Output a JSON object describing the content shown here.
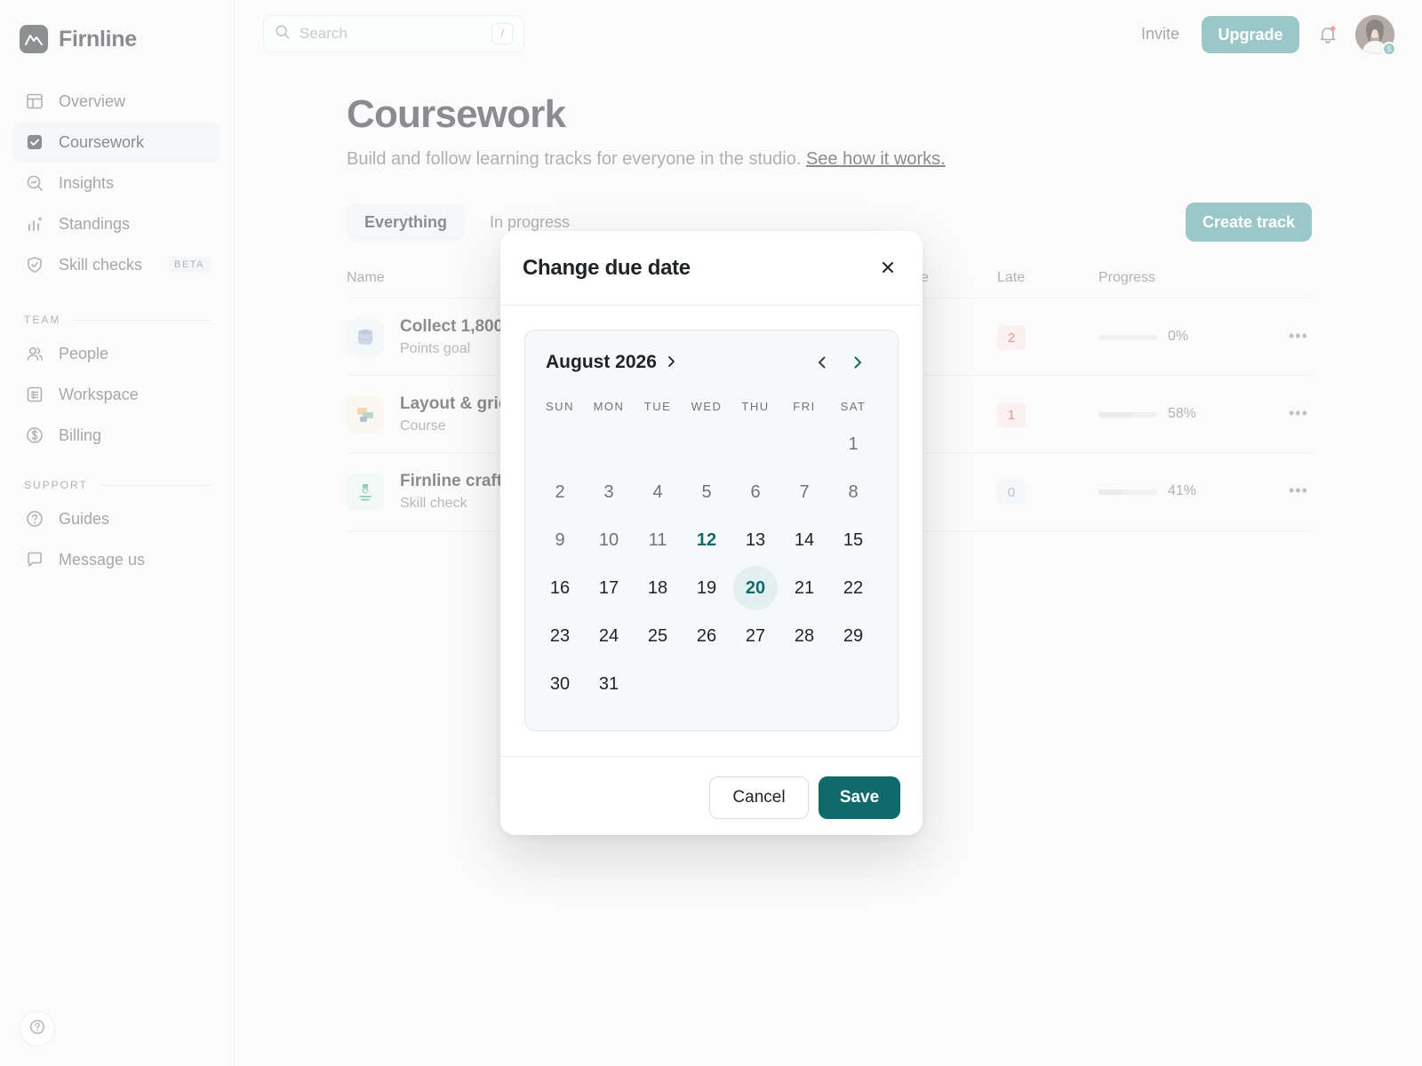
{
  "brand": {
    "name": "Firnline"
  },
  "sidebar": {
    "main_items": [
      {
        "label": "Overview",
        "icon": "layout-icon"
      },
      {
        "label": "Coursework",
        "icon": "checkbox-icon",
        "active": true
      },
      {
        "label": "Insights",
        "icon": "search-chart-icon"
      },
      {
        "label": "Standings",
        "icon": "bar-chart-icon"
      },
      {
        "label": "Skill checks",
        "icon": "shield-check-icon",
        "badge": "BETA"
      }
    ],
    "team_label": "TEAM",
    "team_items": [
      {
        "label": "People",
        "icon": "people-icon"
      },
      {
        "label": "Workspace",
        "icon": "grid-icon"
      },
      {
        "label": "Billing",
        "icon": "dollar-icon"
      }
    ],
    "support_label": "SUPPORT",
    "support_items": [
      {
        "label": "Guides",
        "icon": "help-icon"
      },
      {
        "label": "Message us",
        "icon": "chat-icon"
      }
    ]
  },
  "topbar": {
    "search_placeholder": "Search",
    "search_shortcut": "/",
    "invite_label": "Invite",
    "upgrade_label": "Upgrade",
    "avatar_badge": "S"
  },
  "page": {
    "title": "Coursework",
    "subtitle": "Build and follow learning tracks for everyone in the studio.",
    "subtitle_link": "See how it works.",
    "tabs": [
      "Everything",
      "In progress"
    ],
    "create_label": "Create track"
  },
  "table": {
    "columns": {
      "name": "Name",
      "due_partial": "e",
      "late": "Late",
      "progress": "Progress"
    },
    "rows": [
      {
        "name": "Collect 1,800",
        "type": "Points goal",
        "late": "2",
        "progress": 0,
        "progress_text": "0%"
      },
      {
        "name": "Layout & grid",
        "type": "Course",
        "late": "1",
        "progress": 58,
        "progress_text": "58%"
      },
      {
        "name": "Firnline craft",
        "type": "Skill check",
        "late": "0",
        "progress": 41,
        "progress_text": "41%"
      }
    ]
  },
  "modal": {
    "title": "Change due date",
    "month_label": "August 2026",
    "weekdays": [
      "SUN",
      "MON",
      "TUE",
      "WED",
      "THU",
      "FRI",
      "SAT"
    ],
    "first_weekday_index": 6,
    "days_in_month": 31,
    "today": 12,
    "selected": 20,
    "cancel_label": "Cancel",
    "save_label": "Save"
  },
  "colors": {
    "accent": "#4a9a9c",
    "primary": "#0f6b6b",
    "late_red": "#c0483f"
  }
}
